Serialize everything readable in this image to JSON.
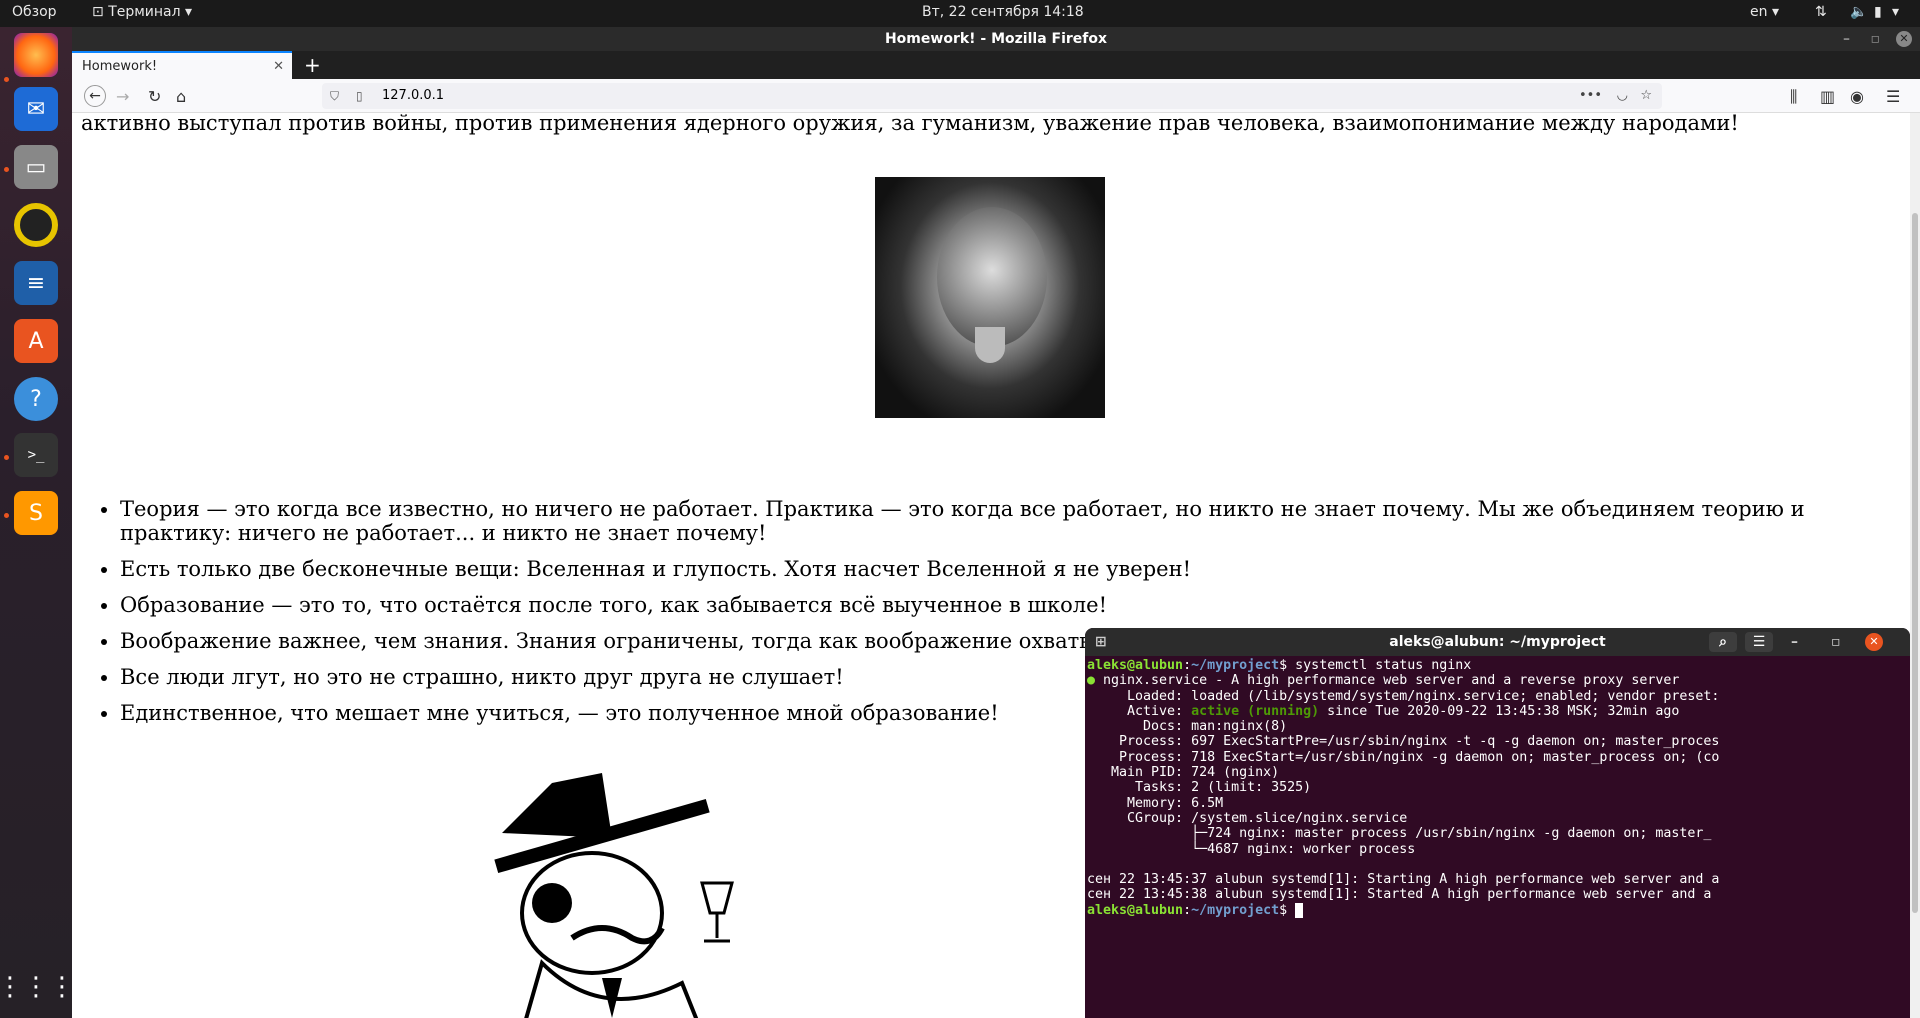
{
  "topbar": {
    "overview": "Обзор",
    "app": "Терминал",
    "datetime": "Вт, 22 сентября  14:18",
    "lang": "en"
  },
  "firefox": {
    "window_title": "Homework! - Mozilla Firefox",
    "tab_title": "Homework!",
    "url": "127.0.0.1"
  },
  "page": {
    "intro": "активно выступал против войны, против применения ядерного оружия, за гуманизм, уважение прав человека, взаимопонимание между народами!",
    "quotes": [
      "Теория — это когда все известно, но ничего не работает. Практика — это когда все работает, но никто не знает почему. Мы же объединяем теорию и практику: ничего не работает... и никто не знает почему!",
      "Есть только две бесконечные вещи: Вселенная и глупость. Хотя насчет Вселенной я не уверен!",
      "Образование — это то, что остаётся после того, как забывается всё выученное в школе!",
      "Воображение важнее, чем знания. Знания ограничены, тогда как воображение охватывает целый мир!",
      "Все люди лгут, но это не страшно, никто друг друга не слушает!",
      "Единственное, что мешает мне учиться, — это полученное мной образование!"
    ]
  },
  "terminal": {
    "title": "aleks@alubun: ~/myproject",
    "prompt_user": "aleks@alubun",
    "prompt_path": "~/myproject",
    "command": "systemctl status nginx",
    "lines": [
      " nginx.service - A high performance web server and a reverse proxy server",
      "     Loaded: loaded (/lib/systemd/system/nginx.service; enabled; vendor preset:",
      "     Active: ",
      "       Docs: man:nginx(8)",
      "    Process: 697 ExecStartPre=/usr/sbin/nginx -t -q -g daemon on; master_proces",
      "    Process: 718 ExecStart=/usr/sbin/nginx -g daemon on; master_process on; (co",
      "   Main PID: 724 (nginx)",
      "      Tasks: 2 (limit: 3525)",
      "     Memory: 6.5M",
      "     CGroup: /system.slice/nginx.service",
      "             ├─724 nginx: master process /usr/sbin/nginx -g daemon on; master_",
      "             └─4687 nginx: worker process",
      "",
      "сен 22 13:45:37 alubun systemd[1]: Starting A high performance web server and a",
      "сен 22 13:45:38 alubun systemd[1]: Started A high performance web server and a "
    ],
    "active_status": "active (running)",
    "active_rest": " since Tue 2020-09-22 13:45:38 MSK; 32min ago"
  }
}
